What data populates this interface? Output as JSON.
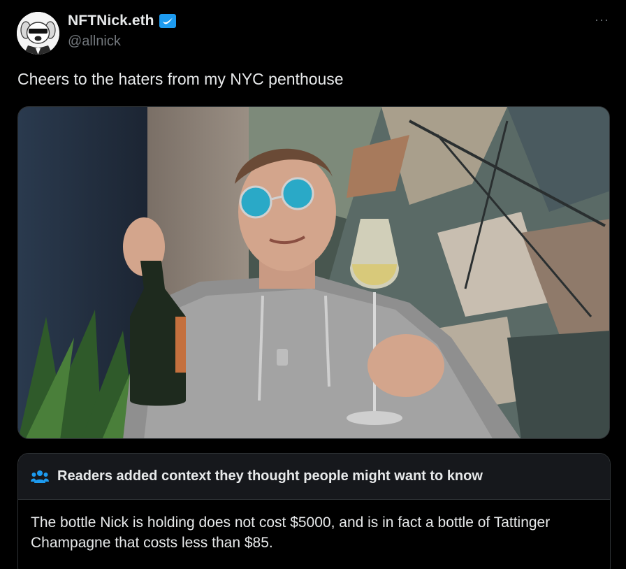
{
  "author": {
    "display_name": "NFTNick.eth",
    "handle": "@allnick",
    "verified_badge_color": "#1d9bf0"
  },
  "more_menu": {
    "icon": "more-horizontal-icon",
    "glyph": "···"
  },
  "tweet": {
    "text": "Cheers to the haters from my NYC penthouse"
  },
  "community_note": {
    "title": "Readers added context they thought people might want to know",
    "icon": "people-icon",
    "icon_color": "#1d9bf0",
    "body": "The bottle Nick is holding does not cost $5000, and is in fact a bottle of Tattinger Champagne that costs less than $85."
  },
  "colors": {
    "background": "#000000",
    "text_primary": "#e7e9ea",
    "text_secondary": "#71767b",
    "border": "#2f3336",
    "note_header_bg": "#16181c",
    "accent": "#1d9bf0"
  }
}
